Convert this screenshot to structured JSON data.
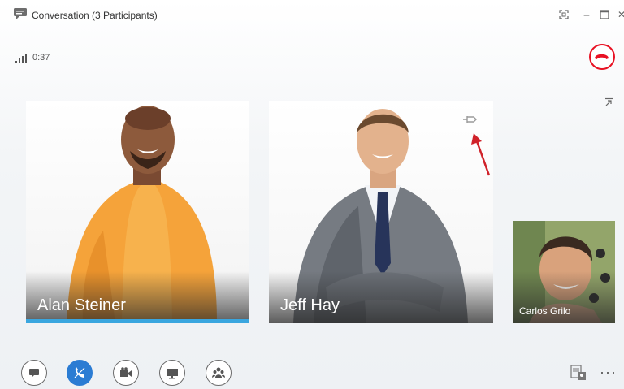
{
  "window": {
    "title": "Conversation (3 Participants)",
    "controls": [
      "full-screen",
      "minimize",
      "maximize",
      "close"
    ],
    "close_glyph": "✕",
    "minimize_glyph": "–"
  },
  "call": {
    "elapsed": "0:37",
    "signal_icon": "signal-strength-icon",
    "end_call_color": "#e81123"
  },
  "participants": [
    {
      "name": "Alan Steiner",
      "speaking": true,
      "accent": "#3aa6df"
    },
    {
      "name": "Jeff Hay",
      "pinned_hover": true
    },
    {
      "name": "Carlos Grilo"
    }
  ],
  "toolbar": {
    "buttons": [
      "im-icon",
      "call-controls-icon",
      "video-icon",
      "present-icon",
      "participants-icon"
    ],
    "active": "call-controls-icon",
    "active_color": "#2b7cd3",
    "more_label": "···"
  }
}
